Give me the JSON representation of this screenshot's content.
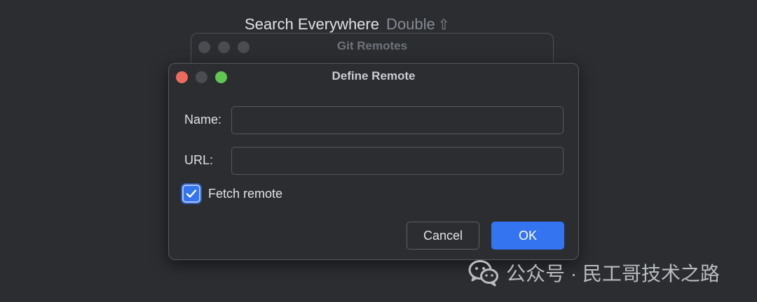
{
  "hint": {
    "text": "Search Everywhere",
    "shortcut": "Double",
    "shortcut_icon": "shift-key-icon"
  },
  "background_window": {
    "title": "Git Remotes"
  },
  "dialog": {
    "title": "Define Remote",
    "name_label": "Name:",
    "name_value": "",
    "url_label": "URL:",
    "url_value": "",
    "fetch_checkbox": {
      "label": "Fetch remote",
      "checked": true
    },
    "cancel_label": "Cancel",
    "ok_label": "OK"
  },
  "watermark": {
    "text": "公众号 · 民工哥技术之路",
    "icon": "wechat-icon"
  },
  "colors": {
    "background": "#2b2d30",
    "accent": "#3574f0",
    "close": "#ed6a5e",
    "zoom": "#61c554",
    "text": "#dfe1e5",
    "muted": "#868a91"
  }
}
